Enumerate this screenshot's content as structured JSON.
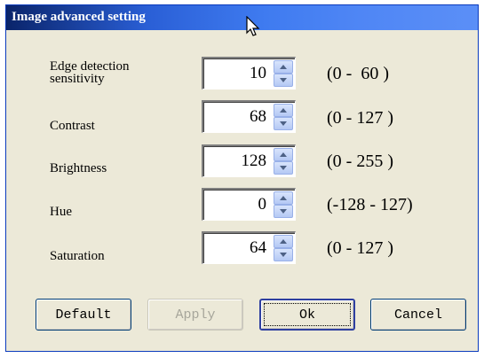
{
  "window": {
    "title": "Image advanced setting"
  },
  "settings": [
    {
      "label_lines": [
        "Edge detection",
        "sensitivity"
      ],
      "value": "10",
      "range": "(0 -  60 )"
    },
    {
      "label_lines": [
        "Contrast"
      ],
      "value": "68",
      "range": "(0 - 127 )"
    },
    {
      "label_lines": [
        "Brightness"
      ],
      "value": "128",
      "range": "(0 - 255 )"
    },
    {
      "label_lines": [
        "Hue"
      ],
      "value": "0",
      "range": "(-128 - 127)"
    },
    {
      "label_lines": [
        "Saturation"
      ],
      "value": "64",
      "range": "(0 - 127 )"
    }
  ],
  "buttons": {
    "default_label": "Default",
    "apply_label": "Apply",
    "ok_label": "Ok",
    "cancel_label": "Cancel"
  },
  "icons": {
    "cursor": "mouse-pointer-icon",
    "spin_up": "chevron-up-icon",
    "spin_down": "chevron-down-icon"
  },
  "colors": {
    "titlebar_start": "#0a246a",
    "titlebar_end": "#5b8ff7",
    "dialog_bg": "#ece9d8"
  }
}
